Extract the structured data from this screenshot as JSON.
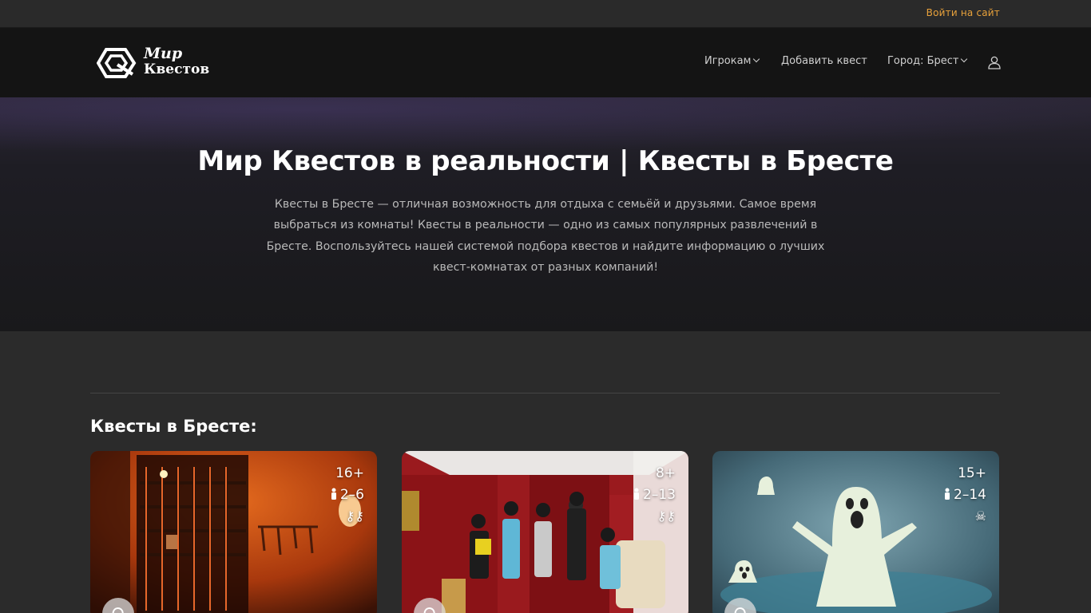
{
  "topbar": {
    "login_label": "Войти на сайт"
  },
  "brand": {
    "line1": "Мир",
    "line2": "Квестов"
  },
  "nav": {
    "players_label": "Игрокам",
    "add_quest_label": "Добавить квест",
    "city_label": "Город: Брест"
  },
  "hero": {
    "title": "Мир Квестов в реальности | Квесты в Бресте",
    "description": "Квесты в Бресте — отличная возможность для отдыха с семьёй и друзьями. Самое время выбраться из комнаты! Квесты в реальности — одно из самых популярных развлечений в Бресте. Воспользуйтесь нашей системой подбора квестов и найдите информацию о лучших квест-комнатах от разных компаний!"
  },
  "section": {
    "title": "Квесты в Бресте:"
  },
  "cards": [
    {
      "age": "16+",
      "players": "2–6",
      "difficulty_icons": "⚷⚷"
    },
    {
      "age": "8+",
      "players": "2–13",
      "difficulty_icons": "⚷⚷"
    },
    {
      "age": "15+",
      "players": "2–14",
      "difficulty_icons": "☠"
    }
  ],
  "colors": {
    "accent": "#e9a23b",
    "nav_bg": "#141414",
    "page_bg": "#2b2b2b"
  }
}
